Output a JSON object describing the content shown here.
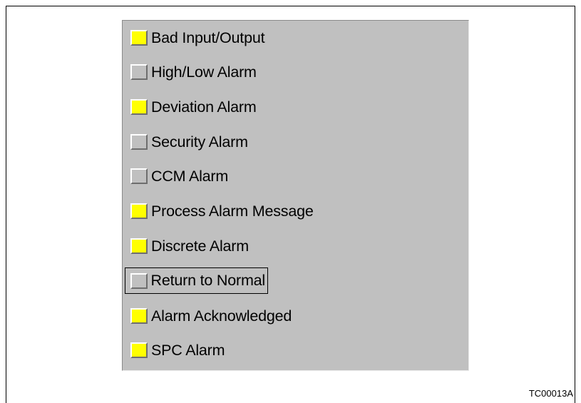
{
  "colors": {
    "on": "#ffff00",
    "off": "#c0c0c0",
    "panel": "#c0c0c0"
  },
  "items": [
    {
      "label": "Bad Input/Output",
      "on": true
    },
    {
      "label": "High/Low Alarm",
      "on": false
    },
    {
      "label": "Deviation Alarm",
      "on": true
    },
    {
      "label": "Security Alarm",
      "on": false
    },
    {
      "label": "CCM Alarm",
      "on": false
    },
    {
      "label": "Process Alarm Message",
      "on": true
    },
    {
      "label": "Discrete Alarm",
      "on": true
    },
    {
      "label": "Return to Normal",
      "on": false,
      "focused": true
    },
    {
      "label": "Alarm Acknowledged",
      "on": true
    },
    {
      "label": "SPC Alarm",
      "on": true
    }
  ],
  "caption": "TC00013A"
}
